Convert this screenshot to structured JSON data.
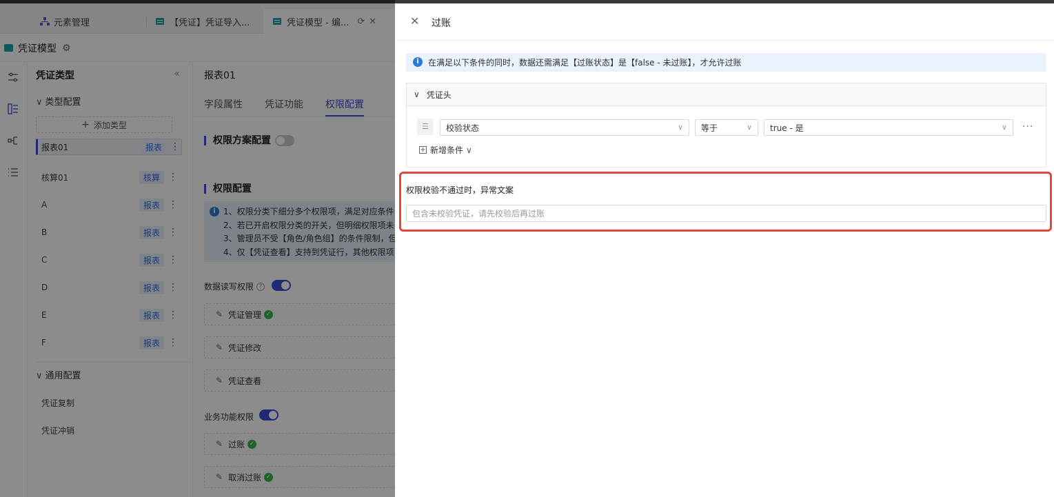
{
  "tabs": [
    {
      "label": "元素管理"
    },
    {
      "label": "【凭证】凭证导入..."
    },
    {
      "label": "凭证模型 - 编..."
    }
  ],
  "module": {
    "title": "凭证模型"
  },
  "type_panel": {
    "title": "凭证类型",
    "type_section": "类型配置",
    "add_type": "添加类型",
    "items": [
      {
        "name": "报表01",
        "badge": "报表"
      },
      {
        "name": "核算01",
        "badge": "核算"
      },
      {
        "name": "A",
        "badge": "报表"
      },
      {
        "name": "B",
        "badge": "报表"
      },
      {
        "name": "C",
        "badge": "报表"
      },
      {
        "name": "D",
        "badge": "报表"
      },
      {
        "name": "E",
        "badge": "报表"
      },
      {
        "name": "F",
        "badge": "报表"
      }
    ],
    "general_section": "通用配置",
    "general_items": [
      "凭证复制",
      "凭证冲销"
    ]
  },
  "main": {
    "title": "报表01",
    "tabs": [
      "字段属性",
      "凭证功能",
      "权限配置"
    ],
    "scheme_label": "权限方案配置",
    "config_label": "权限配置",
    "notes": [
      "1、权限分类下细分多个权限项，满足对应条件",
      "2、若已开启权限分类的开关，但明细权限项未",
      "3、管理员不受【角色/角色组】的条件限制，但",
      "4、仅【凭证查看】支持到凭证行，其他权限项"
    ],
    "data_rw_label": "数据读写权限",
    "data_items": [
      "凭证管理",
      "凭证修改",
      "凭证查看"
    ],
    "biz_label": "业务功能权限",
    "biz_items": [
      "过账",
      "取消过账"
    ]
  },
  "drawer": {
    "title": "过账",
    "info": "在满足以下条件的同时，数据还需满足【过账状态】是【false - 未过账】，才允许过账",
    "group_title": "凭证头",
    "condition": {
      "field": "校验状态",
      "operator": "等于",
      "value": "true - 是"
    },
    "add_condition": "新增条件",
    "message_label": "权限校验不通过时，异常文案",
    "message_placeholder": "包含未校验凭证，请先校验后再过账"
  },
  "colors": {
    "accent": "#3a4bd6",
    "highlight": "#e0463b",
    "success": "#3bb54a",
    "info": "#2f7ad8"
  }
}
